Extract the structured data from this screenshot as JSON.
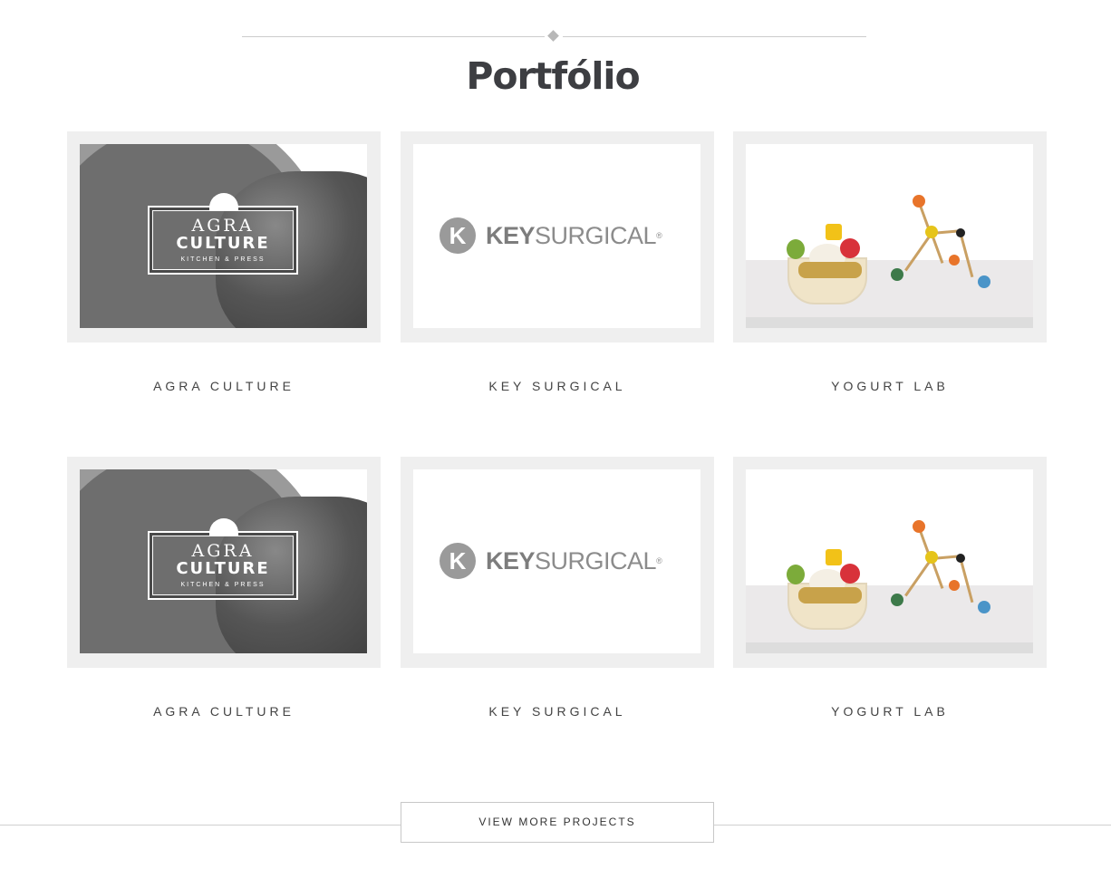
{
  "section": {
    "title": "Portfólio"
  },
  "projects": [
    {
      "name": "AGRA CULTURE",
      "thumbnail": "agra-culture-logo",
      "logo_line1": "AGRA",
      "logo_line2": "CULTURE",
      "logo_line3": "KITCHEN & PRESS"
    },
    {
      "name": "KEY SURGICAL",
      "thumbnail": "key-surgical-logo",
      "logo_mark": "K",
      "logo_bold": "KEY",
      "logo_rest": "SURGICAL",
      "logo_reg": "®"
    },
    {
      "name": "YOGURT LAB",
      "thumbnail": "yogurt-lab-photo"
    },
    {
      "name": "AGRA CULTURE",
      "thumbnail": "agra-culture-logo",
      "logo_line1": "AGRA",
      "logo_line2": "CULTURE",
      "logo_line3": "KITCHEN & PRESS"
    },
    {
      "name": "KEY SURGICAL",
      "thumbnail": "key-surgical-logo",
      "logo_mark": "K",
      "logo_bold": "KEY",
      "logo_rest": "SURGICAL",
      "logo_reg": "®"
    },
    {
      "name": "YOGURT LAB",
      "thumbnail": "yogurt-lab-photo"
    }
  ],
  "view_more": {
    "label": "VIEW MORE PROJECTS"
  },
  "colors": {
    "title": "#3d3e42",
    "card_frame": "#efefef",
    "divider": "#cccccc"
  }
}
